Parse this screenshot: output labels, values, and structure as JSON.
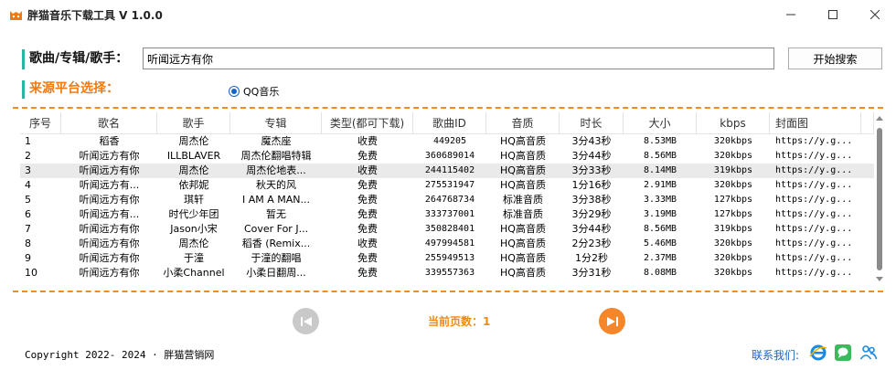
{
  "window": {
    "title": "胖猫音乐下载工具 V 1.0.0"
  },
  "search": {
    "label": "歌曲/专辑/歌手：",
    "value": "听闻远方有你",
    "button_label": "开始搜索"
  },
  "platform": {
    "label": "来源平台选择：",
    "option_label": "QQ音乐",
    "selected": true
  },
  "table": {
    "headers": [
      "序号",
      "歌名",
      "歌手",
      "专辑",
      "类型(都可下载)",
      "歌曲ID",
      "音质",
      "时长",
      "大小",
      "kbps",
      "封面图"
    ],
    "rows": [
      [
        "1",
        "稻香",
        "周杰伦",
        "魔杰座",
        "收费",
        "449205",
        "HQ高音质",
        "3分43秒",
        "8.53MB",
        "320kbps",
        "https://y.g..."
      ],
      [
        "2",
        "听闻远方有你",
        "ILLBLAVER",
        "周杰伦翻唱特辑",
        "免费",
        "360689014",
        "HQ高音质",
        "3分44秒",
        "8.56MB",
        "320kbps",
        "https://y.g..."
      ],
      [
        "3",
        "听闻远方有你",
        "周杰伦",
        "周杰伦地表...",
        "收费",
        "244115402",
        "HQ高音质",
        "3分33秒",
        "8.14MB",
        "319kbps",
        "https://y.g..."
      ],
      [
        "4",
        "听闻远方有...",
        "依邦妮",
        "秋天的风",
        "免费",
        "275531947",
        "HQ高音质",
        "1分16秒",
        "2.91MB",
        "320kbps",
        "https://y.g..."
      ],
      [
        "5",
        "听闻远方有你",
        "琪轩",
        "I AM A MAN...",
        "免费",
        "264768734",
        "标准音质",
        "3分38秒",
        "3.33MB",
        "127kbps",
        "https://y.g..."
      ],
      [
        "6",
        "听闻远方有...",
        "时代少年团",
        "暂无",
        "免费",
        "333737001",
        "标准音质",
        "3分29秒",
        "3.19MB",
        "127kbps",
        "https://y.g..."
      ],
      [
        "7",
        "听闻远方有你",
        "Jason小宋",
        "Cover For J...",
        "免费",
        "350828401",
        "HQ高音质",
        "3分44秒",
        "8.56MB",
        "319kbps",
        "https://y.g..."
      ],
      [
        "8",
        "听闻远方有你",
        "周杰伦",
        "稻香 (Remix...",
        "收费",
        "497994581",
        "HQ高音质",
        "2分23秒",
        "5.46MB",
        "320kbps",
        "https://y.g..."
      ],
      [
        "9",
        "听闻远方有你",
        "于潼",
        "于潼的翻唱",
        "免费",
        "255949513",
        "HQ高音质",
        "1分2秒",
        "2.37MB",
        "320kbps",
        "https://y.g..."
      ],
      [
        "10",
        "听闻远方有你",
        "小柔Channel",
        "小柔日翻周...",
        "免费",
        "339557363",
        "HQ高音质",
        "3分31秒",
        "8.08MB",
        "320kbps",
        "https://y.g..."
      ]
    ],
    "selected_row_index": 2
  },
  "pagination": {
    "indicator": "当前页数：1"
  },
  "footer": {
    "copyright": "Copyright 2022- 2024 · 胖猫营销网",
    "contact_label": "联系我们:"
  },
  "icons": {
    "app": "cat-icon",
    "minimize": "minimize-icon",
    "maximize": "maximize-icon",
    "close": "close-icon",
    "prev": "prev-page-icon",
    "next": "next-page-icon",
    "browser": "browser-icon",
    "chat": "chat-icon",
    "users": "users-icon"
  },
  "colors": {
    "accent_orange": "#f08a10",
    "accent_teal": "#2bb5a3",
    "link_blue": "#1764c8",
    "next_button": "#f5862a",
    "prev_button": "#c9c9c9",
    "selected_row": "#eaeaea"
  }
}
